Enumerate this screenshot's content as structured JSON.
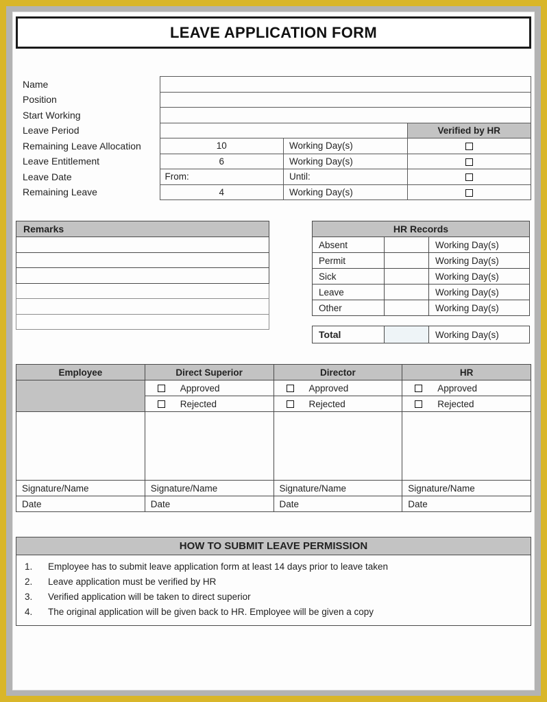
{
  "document": {
    "title": "LEAVE APPLICATION FORM"
  },
  "colors": {
    "frame_outer": "#d9b629",
    "frame_inner": "#b3b3b3",
    "page": "#fdfdfd",
    "header_gray": "#c3c3c3",
    "total_cell_tint": "#eef4f7"
  },
  "info_section": {
    "verified_header": "Verified by HR",
    "rows": [
      {
        "label": "Name",
        "value": "",
        "unit": "",
        "has_checkbox": false
      },
      {
        "label": "Position",
        "value": "",
        "unit": "",
        "has_checkbox": false
      },
      {
        "label": "Start Working",
        "value": "",
        "unit": "",
        "has_checkbox": false
      },
      {
        "label": "Leave Period",
        "value": "",
        "unit": "",
        "has_checkbox": false
      },
      {
        "label": "Remaining Leave Allocation",
        "value": "10",
        "unit": "Working Day(s)",
        "has_checkbox": true
      },
      {
        "label": "Leave Entitlement",
        "value": "6",
        "unit": "Working Day(s)",
        "has_checkbox": true
      },
      {
        "label": "Leave Date",
        "value": "From:",
        "unit": "Until:",
        "has_checkbox": true
      },
      {
        "label": "Remaining Leave",
        "value": "4",
        "unit": "Working Day(s)",
        "has_checkbox": true
      }
    ]
  },
  "remarks": {
    "header": "Remarks",
    "lines": [
      "",
      "",
      "",
      "",
      "",
      ""
    ]
  },
  "hr_records": {
    "header": "HR Records",
    "unit": "Working Day(s)",
    "rows": [
      {
        "label": "Absent",
        "value": ""
      },
      {
        "label": "Permit",
        "value": ""
      },
      {
        "label": "Sick",
        "value": ""
      },
      {
        "label": "Leave",
        "value": ""
      },
      {
        "label": "Other",
        "value": ""
      }
    ],
    "total": {
      "label": "Total",
      "value": "",
      "unit": "Working Day(s)"
    }
  },
  "approval": {
    "columns": [
      {
        "title": "Employee",
        "has_options": false
      },
      {
        "title": "Direct Superior",
        "has_options": true
      },
      {
        "title": "Director",
        "has_options": true
      },
      {
        "title": "HR",
        "has_options": true
      }
    ],
    "option_approved": "Approved",
    "option_rejected": "Rejected",
    "signature_label": "Signature/Name",
    "date_label": "Date"
  },
  "howto": {
    "header": "HOW TO SUBMIT LEAVE PERMISSION",
    "items": [
      {
        "num": "1.",
        "text": "Employee has to submit leave application form at least 14 days prior to leave taken"
      },
      {
        "num": "2.",
        "text": "Leave application must be verified by HR"
      },
      {
        "num": "3.",
        "text": "Verified application will be taken to direct superior"
      },
      {
        "num": "4.",
        "text": "The original application will be given back to HR. Employee will be given a copy"
      }
    ]
  }
}
